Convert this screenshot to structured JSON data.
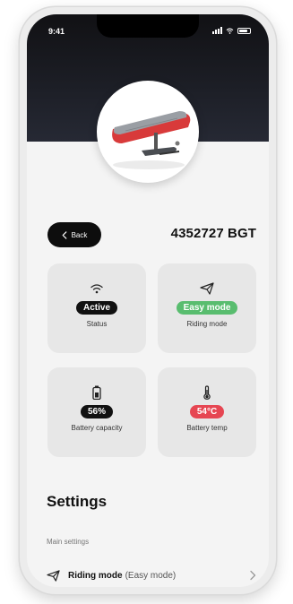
{
  "status_bar": {
    "time": "9:41"
  },
  "header": {
    "back_label": "Back",
    "serial": "4352727 BGT"
  },
  "stats": [
    {
      "id": "status",
      "value": "Active",
      "label": "Status",
      "icon": "wifi-icon",
      "pill_color": "#111111"
    },
    {
      "id": "riding-mode",
      "value": "Easy mode",
      "label": "Riding mode",
      "icon": "paper-plane-icon",
      "pill_color": "#59bd6f"
    },
    {
      "id": "battery-capacity",
      "value": "56%",
      "label": "Battery capacity",
      "icon": "battery-icon",
      "pill_color": "#111111"
    },
    {
      "id": "battery-temp",
      "value": "54°C",
      "label": "Battery temp",
      "icon": "thermometer-icon",
      "pill_color": "#e64652"
    }
  ],
  "settings": {
    "title": "Settings",
    "section_label": "Main settings",
    "rows": [
      {
        "title": "Riding mode",
        "value": "(Easy mode)",
        "icon": "paper-plane-icon"
      }
    ]
  }
}
